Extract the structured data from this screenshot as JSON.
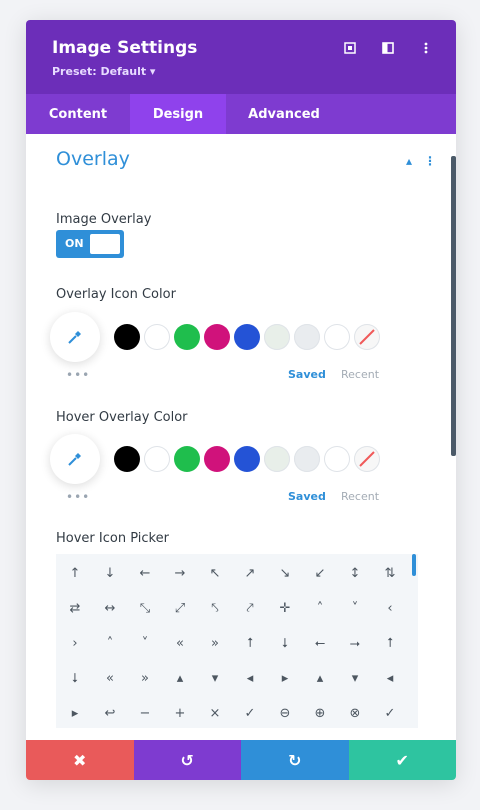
{
  "header": {
    "title": "Image Settings",
    "preset": "Preset: Default ▾",
    "icons": [
      "fullscreen-icon",
      "sidebar-layout-icon",
      "more-vertical-icon"
    ]
  },
  "tabs": [
    {
      "label": "Content",
      "active": false
    },
    {
      "label": "Design",
      "active": true
    },
    {
      "label": "Advanced",
      "active": false
    }
  ],
  "section": {
    "title": "Overlay",
    "collapse_symbol": "▴",
    "menu_symbol": "⋮"
  },
  "image_overlay": {
    "label": "Image Overlay",
    "toggle_text": "ON",
    "enabled": true
  },
  "overlay_icon_color": {
    "label": "Overlay Icon Color",
    "dots": "•••",
    "saved": "Saved",
    "recent": "Recent"
  },
  "hover_overlay_color": {
    "label": "Hover Overlay Color",
    "dots": "•••",
    "saved": "Saved",
    "recent": "Recent"
  },
  "swatches": [
    "#000000",
    "#ffffff",
    "#1fbe4d",
    "#d0127b",
    "#2453d6",
    "#e8efe9",
    "#e9ecef",
    "#ffffff",
    "none"
  ],
  "colors": {
    "header_bg": "#6c2eb9",
    "tabs_bg": "#7e3bd0",
    "tab_active_bg": "#8f42ec",
    "accent": "#2f8fd8",
    "cancel": "#e95a5a",
    "undo": "#7e3bd0",
    "redo": "#2f8fd8",
    "save": "#2ec4a0"
  },
  "hover_icon_picker": {
    "label": "Hover Icon Picker",
    "icons": [
      "↑",
      "↓",
      "←",
      "→",
      "↖",
      "↗",
      "↘",
      "↙",
      "↕",
      "⇅",
      "⇄",
      "↔",
      "⤡",
      "⤢",
      "⤣",
      "⤤",
      "✛",
      "˄",
      "˅",
      "‹",
      "›",
      "˄",
      "˅",
      "«",
      "»",
      "⭡",
      "⭣",
      "⭠",
      "⭢",
      "⭡",
      "⭣",
      "«",
      "»",
      "▴",
      "▾",
      "◂",
      "▸",
      "▴",
      "▾",
      "◂",
      "▸",
      "↩",
      "−",
      "+",
      "×",
      "✓",
      "⊖",
      "⊕",
      "⊗",
      "✓"
    ]
  },
  "footer": {
    "cancel": "✖",
    "undo": "↺",
    "redo": "↻",
    "save": "✔"
  }
}
